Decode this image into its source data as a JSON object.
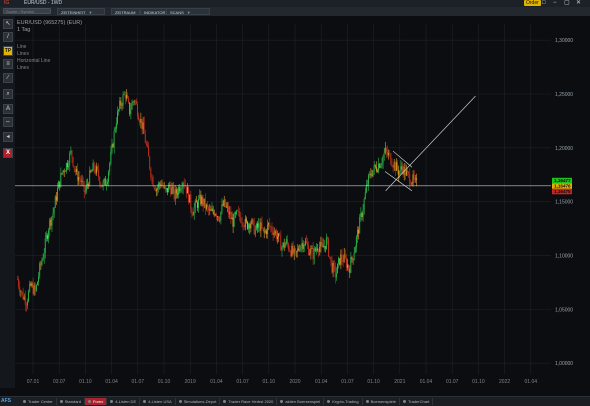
{
  "window": {
    "app_label": "IG",
    "symbol_title": "EUR/USD",
    "period": "1WD",
    "order_button": "Order",
    "controls": [
      "□",
      "−",
      "▢",
      "✕"
    ]
  },
  "toolbar": {
    "search_placeholder": "Suche / Symbol eingeben",
    "menus": [
      {
        "label": "ZEITEINHEIT"
      },
      {
        "label": "ZEITRAUM"
      },
      {
        "label": "INDIKATOR"
      },
      {
        "label": "SCANS"
      }
    ]
  },
  "tools": [
    {
      "name": "cursor-tool",
      "glyph": "↖"
    },
    {
      "name": "line-tool",
      "glyph": "/"
    },
    {
      "name": "tp-tool",
      "glyph": "TP"
    },
    {
      "name": "fib-tool",
      "glyph": "≡"
    },
    {
      "name": "parallel-tool",
      "glyph": "∕"
    },
    {
      "name": "zoom-tool",
      "glyph": "⌕"
    },
    {
      "name": "text-tool",
      "glyph": "A"
    },
    {
      "name": "measure-tool",
      "glyph": "⇔"
    },
    {
      "name": "sound-tool",
      "glyph": "◂"
    },
    {
      "name": "settings-tool",
      "glyph": "▣"
    },
    {
      "name": "delete-tool",
      "glyph": "X"
    }
  ],
  "chart": {
    "instrument": "EUR/USD (965275) (EUR)",
    "timeframe": "1 Tag",
    "drawings": [
      "Line",
      "Lines",
      "Horizontal Line",
      "Lines"
    ],
    "price_labels": [
      "1,30000",
      "1,25000",
      "1,20000",
      "1,15000",
      "1,10000",
      "1,05000",
      "1,00000"
    ],
    "current_prices": [
      {
        "value": "1,16477",
        "color": "#20c020"
      },
      {
        "value": "1,16476",
        "color": "#e0b400"
      },
      {
        "value": "1,16475",
        "color": "#d02020"
      }
    ],
    "time_labels": [
      "07.01",
      "03.07",
      "01.10",
      "01.04",
      "01.07",
      "01.10",
      "2019",
      "01.04",
      "01.07",
      "01.10",
      "2020",
      "01.04",
      "01.07",
      "01.10",
      "2021",
      "01.04",
      "01.07",
      "01.10",
      "2022",
      "01.04"
    ],
    "colors": {
      "up": "#2db84a",
      "down": "#c8301e",
      "neutral": "#e5a02a"
    }
  },
  "chart_data": {
    "type": "candlestick",
    "series": [
      {
        "name": "EUR/USD",
        "close": [
          1.078,
          1.064,
          1.058,
          1.072,
          1.066,
          1.088,
          1.106,
          1.128,
          1.141,
          1.162,
          1.178,
          1.185,
          1.196,
          1.176,
          1.171,
          1.158,
          1.172,
          1.182,
          1.175,
          1.164,
          1.172,
          1.196,
          1.226,
          1.241,
          1.251,
          1.234,
          1.246,
          1.232,
          1.218,
          1.196,
          1.172,
          1.162,
          1.168,
          1.158,
          1.165,
          1.155,
          1.163,
          1.171,
          1.158,
          1.141,
          1.148,
          1.152,
          1.145,
          1.139,
          1.142,
          1.136,
          1.148,
          1.141,
          1.131,
          1.138,
          1.135,
          1.128,
          1.132,
          1.123,
          1.128,
          1.12,
          1.128,
          1.124,
          1.118,
          1.108,
          1.112,
          1.105,
          1.099,
          1.11,
          1.113,
          1.106,
          1.101,
          1.11,
          1.106,
          1.114,
          1.091,
          1.082,
          1.098,
          1.096,
          1.088,
          1.103,
          1.123,
          1.143,
          1.166,
          1.178,
          1.182,
          1.187,
          1.196,
          1.192,
          1.185,
          1.178,
          1.181,
          1.174,
          1.171,
          1.165
        ]
      }
    ],
    "y_axis": {
      "ylim": [
        0.99,
        1.315
      ],
      "ticks": [
        1.3,
        1.25,
        1.2,
        1.15,
        1.1,
        1.05,
        1.0
      ]
    },
    "current_line": 1.16476,
    "drawings": [
      {
        "type": "trend_line",
        "from": [
          82,
          1.16
        ],
        "to": [
          102,
          1.248
        ]
      },
      {
        "type": "horizontal_line",
        "y": 1.16476
      }
    ]
  },
  "statusbar": {
    "logo": "AFS",
    "tabs": [
      {
        "label": "Trader Center",
        "active": false
      },
      {
        "label": "Standard",
        "active": false
      },
      {
        "label": "Forex",
        "active": true
      },
      {
        "label": "4-Listen DE",
        "active": false
      },
      {
        "label": "4-Listen USA",
        "active": false
      },
      {
        "label": "Simulations-Depot",
        "active": false
      },
      {
        "label": "Trader Race Herbst 2020",
        "active": false
      },
      {
        "label": "aktien Boersenspiel",
        "active": false
      },
      {
        "label": "Krypto-Trading",
        "active": false
      },
      {
        "label": "Boersenspiele",
        "active": false
      },
      {
        "label": "TraderChart",
        "active": false
      }
    ]
  }
}
